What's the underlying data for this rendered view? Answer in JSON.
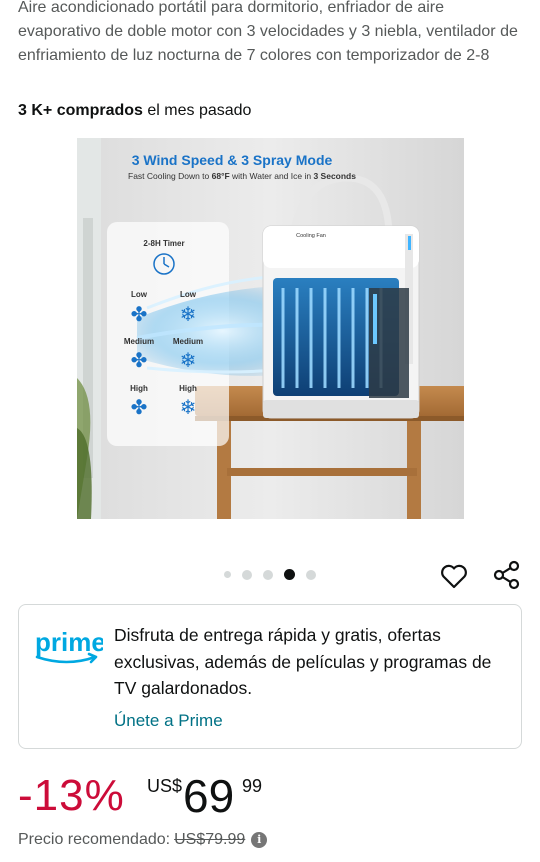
{
  "product": {
    "title": "Aire acondicionado portátil para dormitorio, enfriador de aire evaporativo de doble motor con 3 velocidades y 3 niebla, ventilador de enfriamiento de luz nocturna de 7 colores con temporizador de 2-8",
    "bought_count": "3 K+ comprados",
    "bought_suffix": " el mes pasado"
  },
  "image": {
    "headline": "3 Wind Speed & 3 Spray Mode",
    "subline_prefix": "Fast Cooling Down to ",
    "subline_temp": "68°F",
    "subline_mid": " with Water and Ice in ",
    "subline_time": "3 Seconds",
    "timer_label": "2-8H Timer",
    "device_label": "Cooling Fan",
    "speed_labels": [
      "Low",
      "Low",
      "Medium",
      "Medium",
      "High",
      "High"
    ]
  },
  "carousel": {
    "total": 5,
    "active_index": 3
  },
  "actions": {
    "favorite_icon": "heart-icon",
    "share_icon": "share-icon"
  },
  "prime": {
    "logo_text": "prime",
    "description": "Disfruta de entrega rápida y gratis, ofertas exclusivas, además de películas y programas de TV galardonados.",
    "link": "Únete a Prime",
    "brand_color": "#00a8e1"
  },
  "price": {
    "discount": "-13%",
    "currency": "US$",
    "whole": "69",
    "fraction": "99",
    "list_label": "Precio recomendado:",
    "list_price": "US$79.99",
    "info_icon": "info-icon",
    "discount_color": "#cc0c39"
  }
}
